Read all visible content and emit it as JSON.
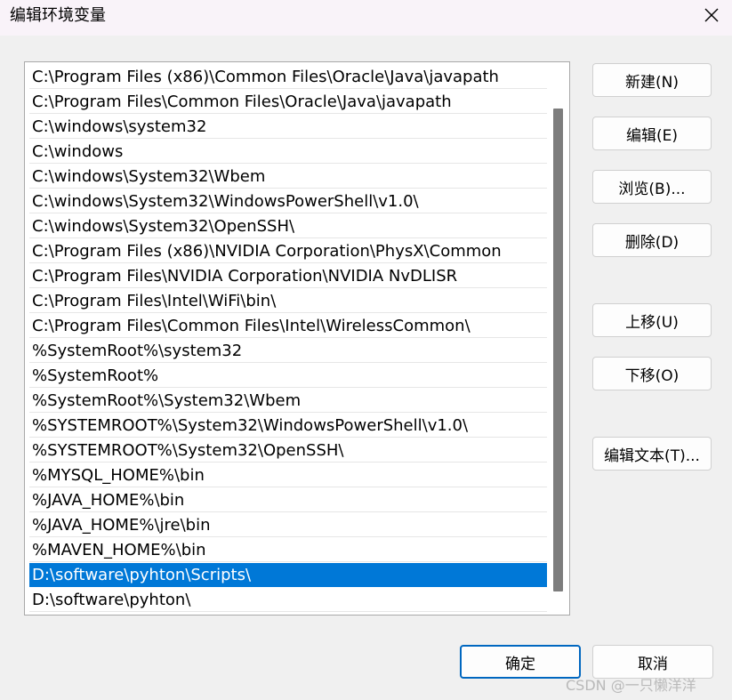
{
  "window": {
    "title": "编辑环境变量"
  },
  "paths": [
    "C:\\Program Files (x86)\\Common Files\\Oracle\\Java\\javapath",
    "C:\\Program Files\\Common Files\\Oracle\\Java\\javapath",
    "C:\\windows\\system32",
    "C:\\windows",
    "C:\\windows\\System32\\Wbem",
    "C:\\windows\\System32\\WindowsPowerShell\\v1.0\\",
    "C:\\windows\\System32\\OpenSSH\\",
    "C:\\Program Files (x86)\\NVIDIA Corporation\\PhysX\\Common",
    "C:\\Program Files\\NVIDIA Corporation\\NVIDIA NvDLISR",
    "C:\\Program Files\\Intel\\WiFi\\bin\\",
    "C:\\Program Files\\Common Files\\Intel\\WirelessCommon\\",
    "%SystemRoot%\\system32",
    "%SystemRoot%",
    "%SystemRoot%\\System32\\Wbem",
    "%SYSTEMROOT%\\System32\\WindowsPowerShell\\v1.0\\",
    "%SYSTEMROOT%\\System32\\OpenSSH\\",
    "%MYSQL_HOME%\\bin",
    "%JAVA_HOME%\\bin",
    "%JAVA_HOME%\\jre\\bin",
    "%MAVEN_HOME%\\bin",
    "D:\\software\\pyhton\\Scripts\\",
    "D:\\software\\pyhton\\"
  ],
  "selected_path": "D:\\software\\pyhton\\Scripts\\",
  "buttons": {
    "new": "新建(N)",
    "edit": "编辑(E)",
    "browse": "浏览(B)...",
    "delete": "删除(D)",
    "move_up": "上移(U)",
    "move_down": "下移(O)",
    "edit_text": "编辑文本(T)...",
    "ok": "确定",
    "cancel": "取消"
  },
  "icons": {
    "close": "close-icon"
  },
  "colors": {
    "selection": "#0078d7",
    "primary_border": "#0067c0"
  },
  "watermark": "CSDN @一只懒洋洋"
}
